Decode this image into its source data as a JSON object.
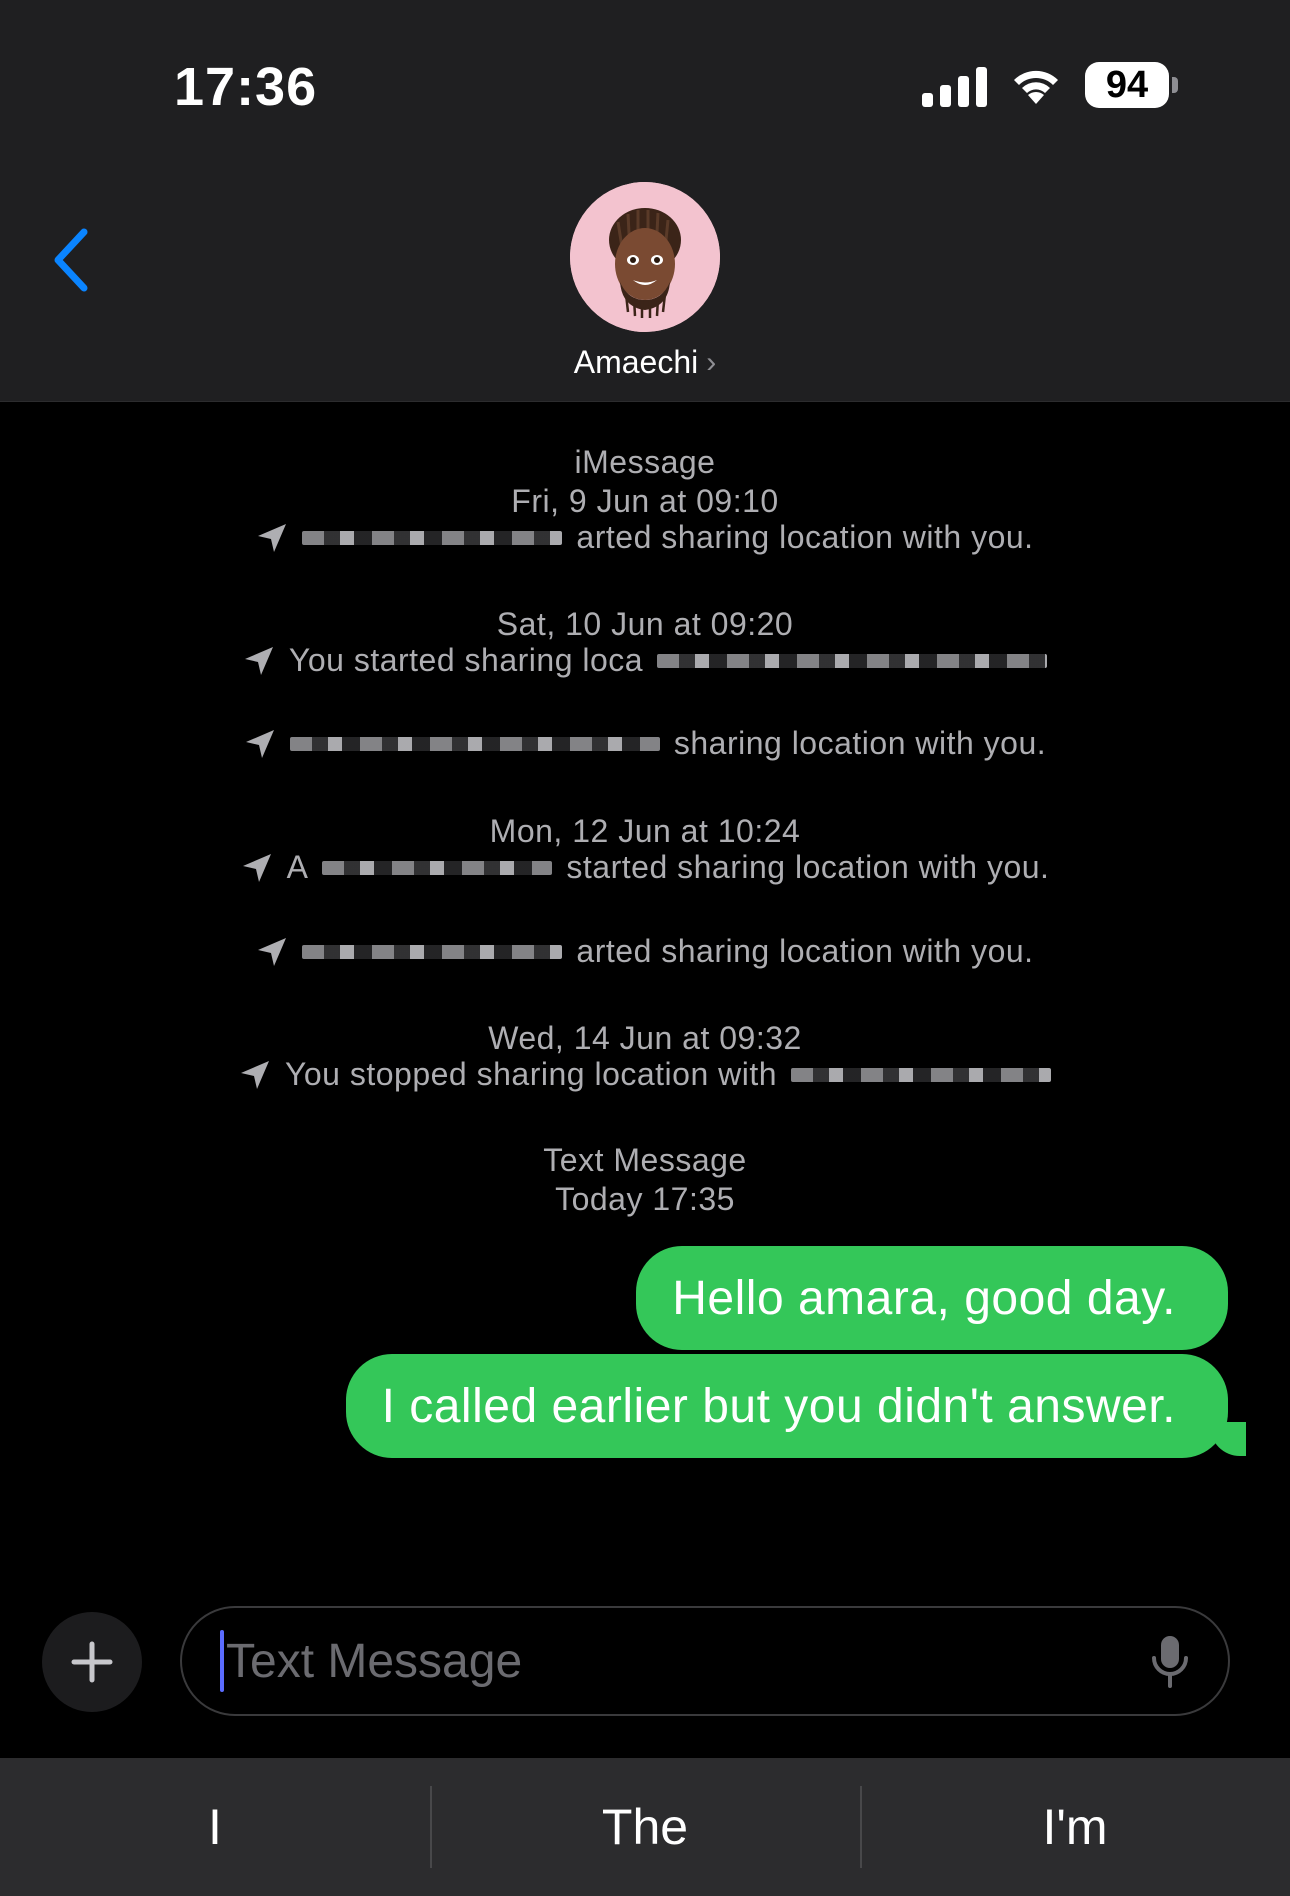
{
  "status_bar": {
    "time": "17:36",
    "battery": "94"
  },
  "header": {
    "contact_name": "Amaechi",
    "name_chevron": "›"
  },
  "conversation": {
    "service_label": "iMessage",
    "date_1": "Fri, 9 Jun at 09:10",
    "loc_1_text": "arted sharing location with you.",
    "date_2": "Sat, 10 Jun at 09:20",
    "loc_2_text": "You started sharing loca",
    "loc_3_text": "sharing location with you.",
    "date_3": "Mon, 12 Jun at 10:24",
    "loc_4_prefix": "A",
    "loc_4_text": "started sharing location with you.",
    "loc_5_text": "arted sharing location with you.",
    "date_4": "Wed, 14 Jun at 09:32",
    "loc_6_text": "You stopped sharing location with",
    "sms_label": "Text Message",
    "sms_date": "Today 17:35",
    "messages": [
      {
        "text": "Hello amara, good day."
      },
      {
        "text": "I called earlier but you didn't answer."
      }
    ]
  },
  "input": {
    "placeholder": "Text Message"
  },
  "suggestions": [
    "I",
    "The",
    "I'm"
  ],
  "colors": {
    "bubble": "#34c759",
    "accent": "#0a84ff",
    "avatar_bg": "#f3c3cf"
  }
}
